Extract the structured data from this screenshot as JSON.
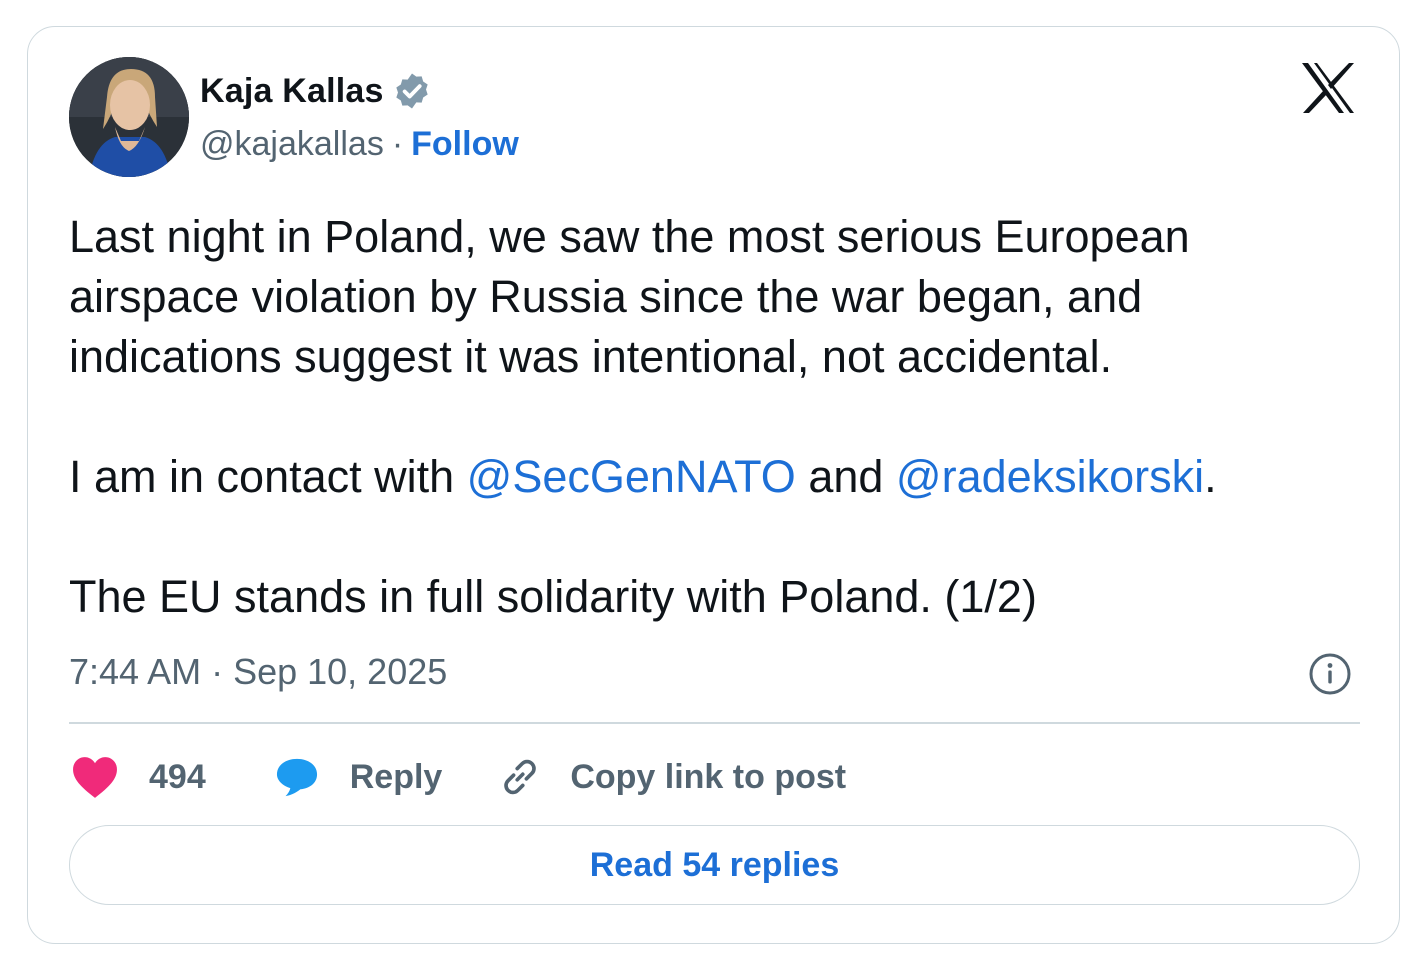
{
  "author": {
    "name": "Kaja Kallas",
    "handle": "@kajakallas",
    "separator": "·",
    "follow_label": "Follow",
    "verified": true
  },
  "tweet": {
    "paragraph1": "Last night in Poland, we saw the most serious European airspace violation by Russia since the war began, and indications suggest it was intentional, not accidental.",
    "paragraph2_prefix": "I am in contact with ",
    "mention1": "@SecGenNATO",
    "paragraph2_middle": " and ",
    "mention2": "@radeksikorski",
    "paragraph2_suffix": ".",
    "paragraph3": "The EU stands in full solidarity with Poland. (1/2)"
  },
  "timestamp": "7:44 AM · Sep 10, 2025",
  "actions": {
    "like_count": "494",
    "reply_label": "Reply",
    "copy_label": "Copy link to post"
  },
  "read_replies_label": "Read 54 replies",
  "colors": {
    "link": "#1d6fd6",
    "like": "#f02a7a",
    "reply": "#1d9bf0",
    "muted": "#536471",
    "text": "#0f1419",
    "border": "#cfd9de"
  },
  "icons": [
    "avatar-photo",
    "verified-badge-icon",
    "x-logo-icon",
    "info-icon",
    "heart-icon",
    "reply-bubble-icon",
    "link-icon"
  ]
}
